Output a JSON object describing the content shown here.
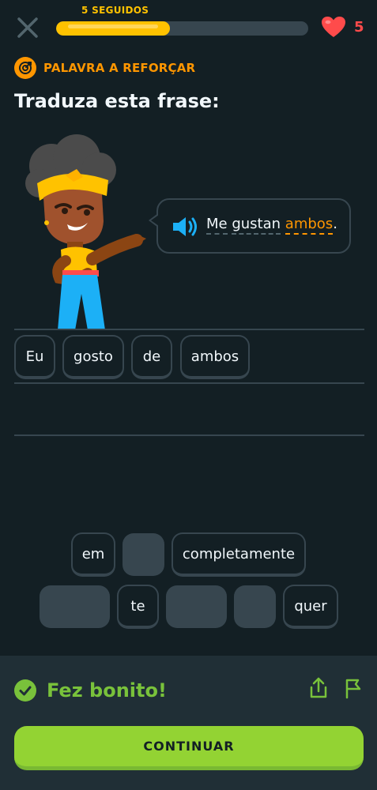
{
  "header": {
    "streak_label": "5 SEGUIDOS",
    "progress": 0.45,
    "hearts": "5",
    "icons": {
      "close": "close-icon",
      "heart": "heart-icon"
    }
  },
  "challenge": {
    "tag": "PALAVRA A REFORÇAR",
    "instruction": "Traduza esta frase:",
    "sentence_words": [
      "Me",
      "gustan",
      "ambos"
    ],
    "sentence_punct": ".",
    "highlighted_word": "ambos"
  },
  "answer_words": [
    "Eu",
    "gosto",
    "de",
    "ambos"
  ],
  "word_bank": {
    "row1": [
      "em",
      "completamente"
    ],
    "row2": [
      "te",
      "quer"
    ]
  },
  "footer": {
    "result": "Fez bonito!",
    "continue_label": "CONTINUAR"
  },
  "colors": {
    "background": "#131f24",
    "accent_orange": "#ff9600",
    "streak_yellow": "#ffc200",
    "heart_red": "#ff4b4b",
    "success_green": "#79c23b",
    "button_green": "#93d333"
  }
}
